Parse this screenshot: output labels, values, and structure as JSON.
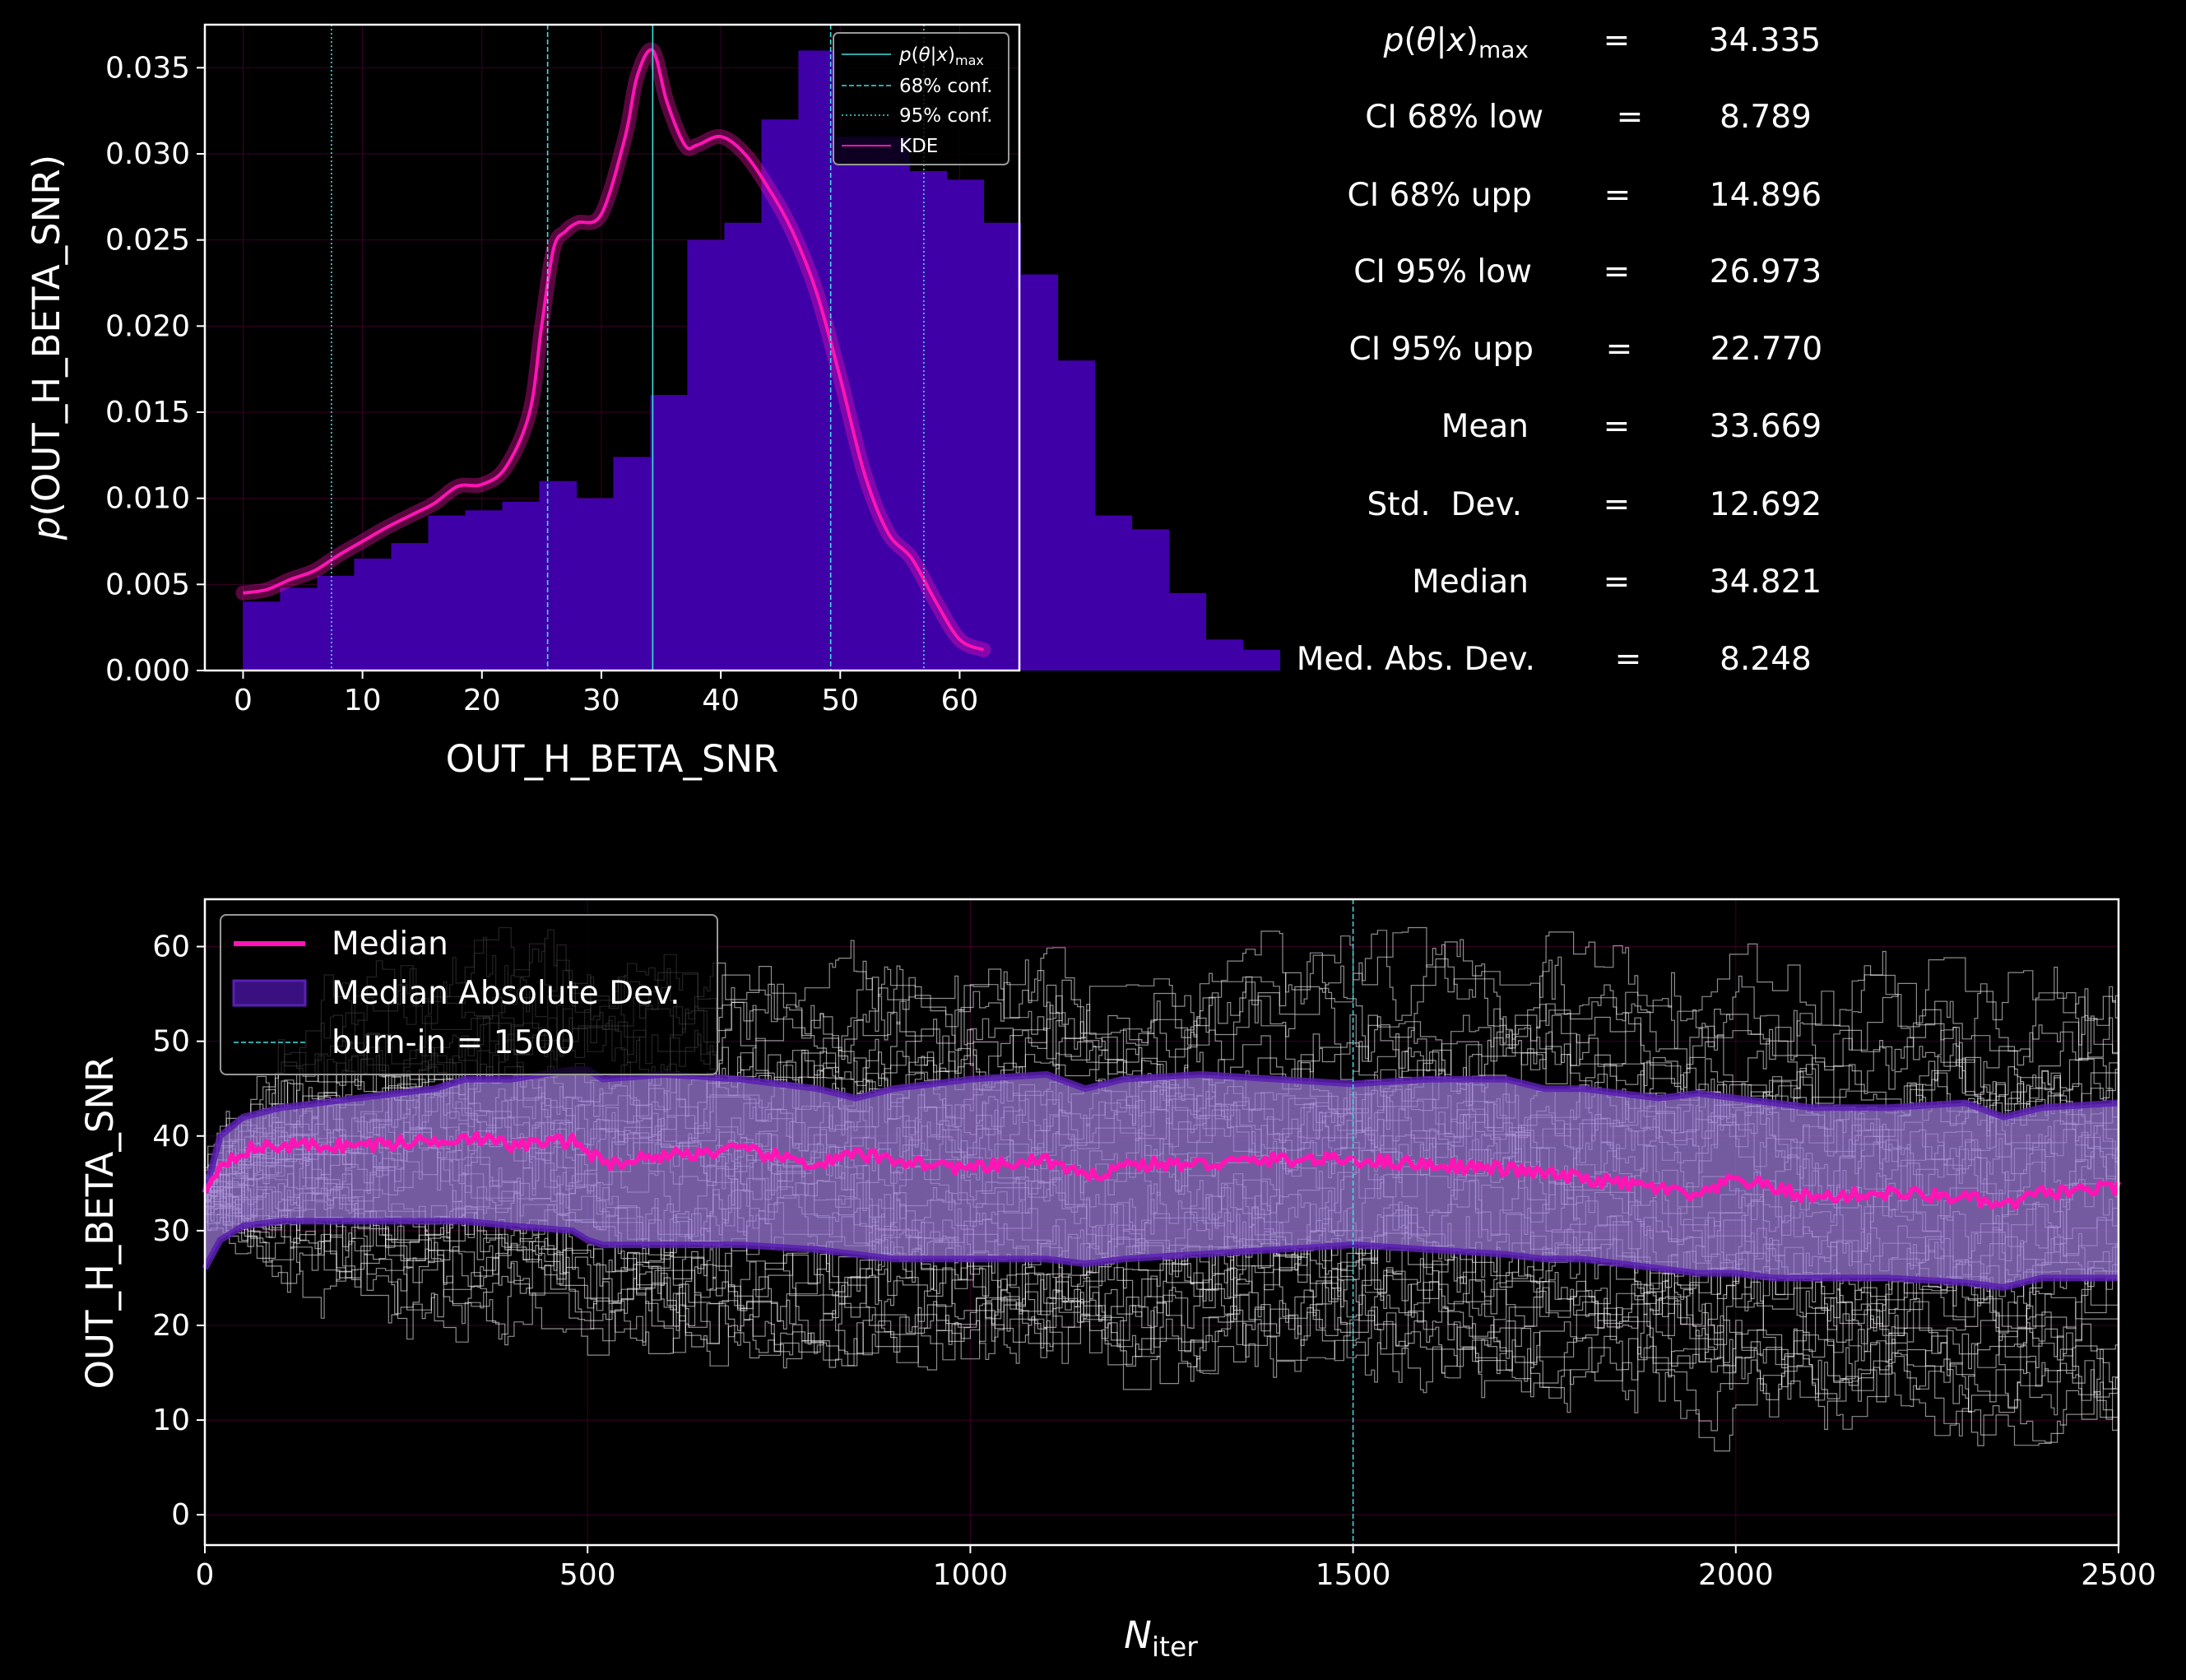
{
  "colors": {
    "background": "#000000",
    "hist": "#4000a8",
    "kde": "#ff14b4",
    "cyan": "#3fe0e0",
    "band": "#9b7ad6",
    "band_edge": "#5a1fb3",
    "walker": "#ffffff",
    "grid": "#3a0028"
  },
  "chart_data": [
    {
      "type": "bar",
      "xlabel": "OUT_H_BETA_SNR",
      "ylabel_italic": "p",
      "ylabel_rest": "(OUT_H_BETA_SNR)",
      "xlim": [
        -3.2,
        65
      ],
      "ylim": [
        0,
        0.0375
      ],
      "xticks": [
        "0",
        "10",
        "20",
        "30",
        "40",
        "50",
        "60"
      ],
      "yticks": [
        "0.000",
        "0.005",
        "0.010",
        "0.015",
        "0.020",
        "0.025",
        "0.030",
        "0.035"
      ],
      "bin_width": 3.1,
      "bin_start": 0,
      "values": [
        0.004,
        0.0048,
        0.0055,
        0.0065,
        0.0074,
        0.009,
        0.0093,
        0.0098,
        0.011,
        0.01,
        0.0124,
        0.016,
        0.025,
        0.026,
        0.032,
        0.036,
        0.031,
        0.031,
        0.029,
        0.0285,
        0.026,
        0.023,
        0.018,
        0.009,
        0.0082,
        0.0045,
        0.0018,
        0.0012
      ],
      "kde": {
        "x": [
          0,
          2,
          4,
          6,
          8,
          10,
          12,
          14,
          16,
          18,
          20,
          22,
          24,
          25,
          26,
          27,
          28,
          30,
          32,
          33,
          34.3,
          35.5,
          37,
          38,
          40,
          42,
          44,
          46,
          48,
          50,
          52,
          54,
          56,
          58,
          60,
          62
        ],
        "y": [
          0.0045,
          0.0047,
          0.0053,
          0.0058,
          0.0067,
          0.0075,
          0.0083,
          0.009,
          0.0097,
          0.0107,
          0.0108,
          0.0118,
          0.015,
          0.02,
          0.0245,
          0.0255,
          0.026,
          0.0265,
          0.031,
          0.0345,
          0.036,
          0.033,
          0.0305,
          0.0305,
          0.031,
          0.03,
          0.028,
          0.0255,
          0.022,
          0.017,
          0.0115,
          0.008,
          0.0065,
          0.004,
          0.0018,
          0.0012
        ]
      },
      "vlines": {
        "max": 34.3,
        "ci68": [
          25.5,
          49.2
        ],
        "ci95": [
          7.4,
          57.0
        ]
      },
      "legend": {
        "entries": [
          "p(θ|x)max",
          "68% conf.",
          "95% conf.",
          "KDE"
        ],
        "placement": "upper right"
      }
    },
    {
      "type": "line",
      "xlabel_main": "N",
      "xlabel_sub": "iter",
      "ylabel": "OUT_H_BETA_SNR",
      "xlim": [
        0,
        2500
      ],
      "ylim": [
        -3.2,
        65
      ],
      "xticks": [
        "0",
        "500",
        "1000",
        "1500",
        "2000",
        "2500"
      ],
      "yticks": [
        "0",
        "10",
        "20",
        "30",
        "40",
        "50",
        "60"
      ],
      "burn_in": 1500,
      "median": {
        "x": [
          0,
          20,
          50,
          100,
          200,
          300,
          340,
          400,
          480,
          500,
          520,
          600,
          700,
          800,
          850,
          900,
          1000,
          1100,
          1150,
          1200,
          1300,
          1400,
          1500,
          1600,
          1700,
          1750,
          1800,
          1900,
          1950,
          2000,
          2050,
          2100,
          2200,
          2300,
          2350,
          2400,
          2500
        ],
        "y": [
          34,
          37,
          38.5,
          39,
          39,
          39.5,
          40,
          39,
          39.5,
          38.5,
          37,
          38,
          38.5,
          37,
          38,
          37.5,
          36.5,
          37.5,
          35.5,
          37,
          37,
          37.5,
          37.5,
          37,
          36.5,
          36,
          35.5,
          34.5,
          33.5,
          35.5,
          34.5,
          33.5,
          34,
          33.5,
          32.5,
          34,
          34.5
        ]
      },
      "mad": {
        "upper": [
          34,
          40,
          42,
          43,
          44,
          45,
          46,
          46,
          47,
          47,
          46,
          46.5,
          46,
          45,
          44,
          45,
          46,
          46.5,
          45,
          46,
          46.5,
          46,
          45.5,
          46,
          46,
          45,
          45,
          44,
          44.5,
          44,
          43.5,
          43,
          43,
          43.5,
          42,
          43,
          43.5
        ],
        "lower": [
          26,
          29,
          30.5,
          31,
          31,
          31,
          31,
          30.5,
          30,
          29,
          28.5,
          28.5,
          28.5,
          28,
          27.5,
          27,
          27,
          27,
          26.5,
          27,
          27.5,
          28,
          28.5,
          28,
          27.5,
          27,
          27,
          26,
          25.5,
          25.5,
          25,
          25,
          25,
          24.5,
          24,
          25,
          25
        ]
      },
      "legend": {
        "entries": [
          "Median",
          "Median Absolute Dev.",
          "burn-in = 1500"
        ],
        "placement": "upper left"
      }
    }
  ],
  "stats": [
    {
      "label": "p(θ|x)max",
      "value": "34.335"
    },
    {
      "label": "CI 68% low",
      "value": "8.789"
    },
    {
      "label": "CI 68% upp",
      "value": "14.896"
    },
    {
      "label": "CI 95% low",
      "value": "26.973"
    },
    {
      "label": "CI 95% upp",
      "value": "22.770"
    },
    {
      "label": "Mean",
      "value": "33.669"
    },
    {
      "label": "Std.  Dev.",
      "value": "12.692"
    },
    {
      "label": "Median",
      "value": "34.821"
    },
    {
      "label": "Med. Abs. Dev.",
      "value": "8.248"
    }
  ],
  "stats_equals": "="
}
